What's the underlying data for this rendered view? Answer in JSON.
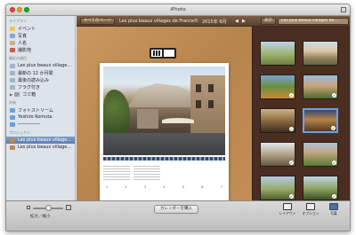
{
  "app": {
    "title": "iPhoto"
  },
  "sidebar": {
    "sections": [
      {
        "heading": "ライブラリ",
        "items": [
          {
            "label": "イベント",
            "icon": "events-icon"
          },
          {
            "label": "写真",
            "icon": "photos-icon"
          },
          {
            "label": "人名",
            "icon": "people-icon"
          },
          {
            "label": "撮影地",
            "icon": "places-icon"
          }
        ]
      },
      {
        "heading": "最近の項目",
        "items": [
          {
            "label": "Les plus beaux village…",
            "icon": "album-icon"
          },
          {
            "label": "最新の 12 か月間",
            "icon": "album-icon"
          },
          {
            "label": "最後の読み込み",
            "icon": "album-icon"
          },
          {
            "label": "フラグ付き",
            "icon": "album-icon"
          },
          {
            "label": "ゴミ箱",
            "icon": "trash-icon"
          }
        ]
      },
      {
        "heading": "共有",
        "items": [
          {
            "label": "フォトストリーム",
            "icon": "stream-icon"
          },
          {
            "label": "Yoshiro Komuta",
            "icon": "stream-icon"
          },
          {
            "label": "―――――",
            "icon": "stream-icon"
          }
        ]
      },
      {
        "heading": "プロジェクト",
        "items": [
          {
            "label": "Les plus beaux village…",
            "icon": "project-icon",
            "selected": true
          },
          {
            "label": "Les plus beaux village…",
            "icon": "project-icon"
          }
        ]
      }
    ]
  },
  "toolbar": {
    "all_pages": "すべてのページ",
    "project_title": "Les plus beaux villages de France©",
    "month": "2015年 6月",
    "prev": "◀",
    "next": "▶",
    "show_label": "表示",
    "album_select": "Les plus beaux villages de…"
  },
  "bottombar": {
    "zoom_label": "拡大／縮小",
    "add_calendar": "カレンダーを購入",
    "zoom_level": 0.5,
    "tools": [
      {
        "label": "レイアウト"
      },
      {
        "label": "オプション"
      },
      {
        "label": "写真",
        "selected": true
      }
    ]
  },
  "calendar": {
    "days": [
      "1",
      "2",
      "3",
      "4",
      "5",
      "6",
      "7"
    ]
  }
}
